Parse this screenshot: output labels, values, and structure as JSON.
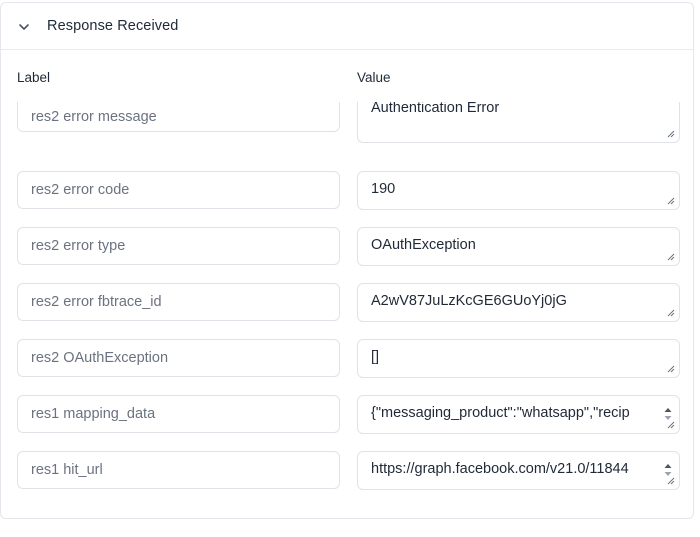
{
  "header": {
    "title": "Response Received",
    "toggle_icon": "chevron-down-icon"
  },
  "columns": {
    "label": "Label",
    "value": "Value"
  },
  "rows": [
    {
      "label": "res2 error message",
      "value": "Authentication Error"
    },
    {
      "label": "res2 error code",
      "value": "190"
    },
    {
      "label": "res2 error type",
      "value": "OAuthException"
    },
    {
      "label": "res2 error fbtrace_id",
      "value": "A2wV87JuLzKcGE6GUoYj0jG"
    },
    {
      "label": "res2 OAuthException",
      "value": "[]"
    },
    {
      "label": "res1 mapping_data",
      "value": "{\"messaging_product\":\"whatsapp\",\"recip"
    },
    {
      "label": "res1 hit_url",
      "value": "https://graph.facebook.com/v21.0/11844"
    }
  ]
}
